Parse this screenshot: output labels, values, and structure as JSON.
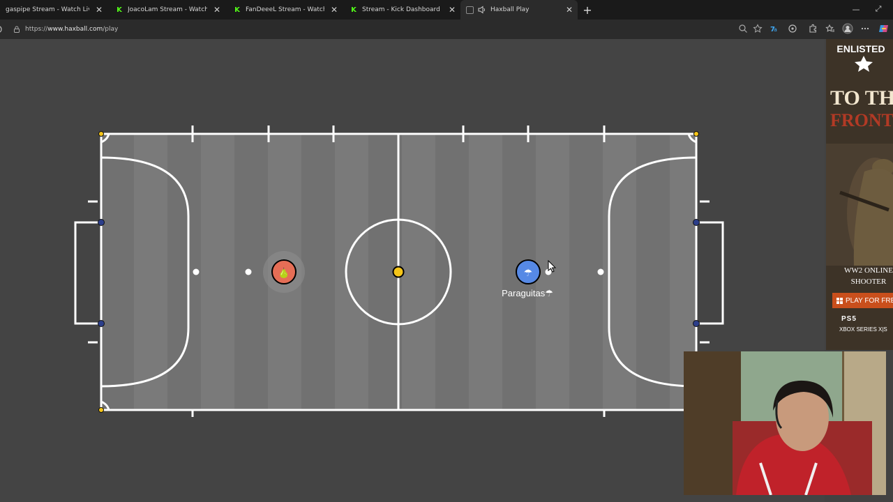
{
  "browser": {
    "tabs": [
      {
        "title": "gaspipe Stream - Watch Live on Kick",
        "icon": "kick-icon",
        "active": false
      },
      {
        "title": "JoacoLam Stream - Watch Live on Kick",
        "icon": "kick-icon",
        "active": false
      },
      {
        "title": "FanDeeeL Stream - Watch Live on Kick",
        "icon": "kick-icon",
        "active": false
      },
      {
        "title": "Stream - Kick Dashboard",
        "icon": "kick-icon",
        "active": false
      },
      {
        "title": "Haxball Play",
        "icon": "haxball-icon",
        "active": true,
        "audio": true
      }
    ],
    "new_tab_icon": "plus-icon",
    "url_prefix": "https://",
    "url_host": "www.haxball.com",
    "url_path": "/play",
    "toolbar_icons": [
      "zoom-icon",
      "favorite-star-icon",
      "extension-translate-icon",
      "extension-puzzle-icon",
      "extension-icon",
      "favorites-icon",
      "profile-icon",
      "menu-icon",
      "copilot-icon"
    ]
  },
  "game": {
    "field_color": "#757575",
    "line_color": "#ffffff",
    "ball_color": "#f5c518",
    "red_team_color": "#e56e56",
    "blue_team_color": "#5689e5",
    "players": [
      {
        "team": "red",
        "avatar": "🍐",
        "name": ""
      },
      {
        "team": "blue",
        "avatar": "☂",
        "name": "Paraguitas☂"
      }
    ]
  },
  "ad": {
    "logo": "ENLISTED",
    "headline_1": "TO THE",
    "headline_2": "FRONT",
    "tagline_1": "WW2 ONLINE",
    "tagline_2": "SHOOTER",
    "cta": "PLAY FOR FREE",
    "platform_ps5": "PS5",
    "platform_xbox": "XBOX SERIES X|S",
    "accent": "#c94f1c"
  },
  "webcam": {
    "shirt_color": "#c0222a",
    "wall_color": "#7a6444"
  }
}
